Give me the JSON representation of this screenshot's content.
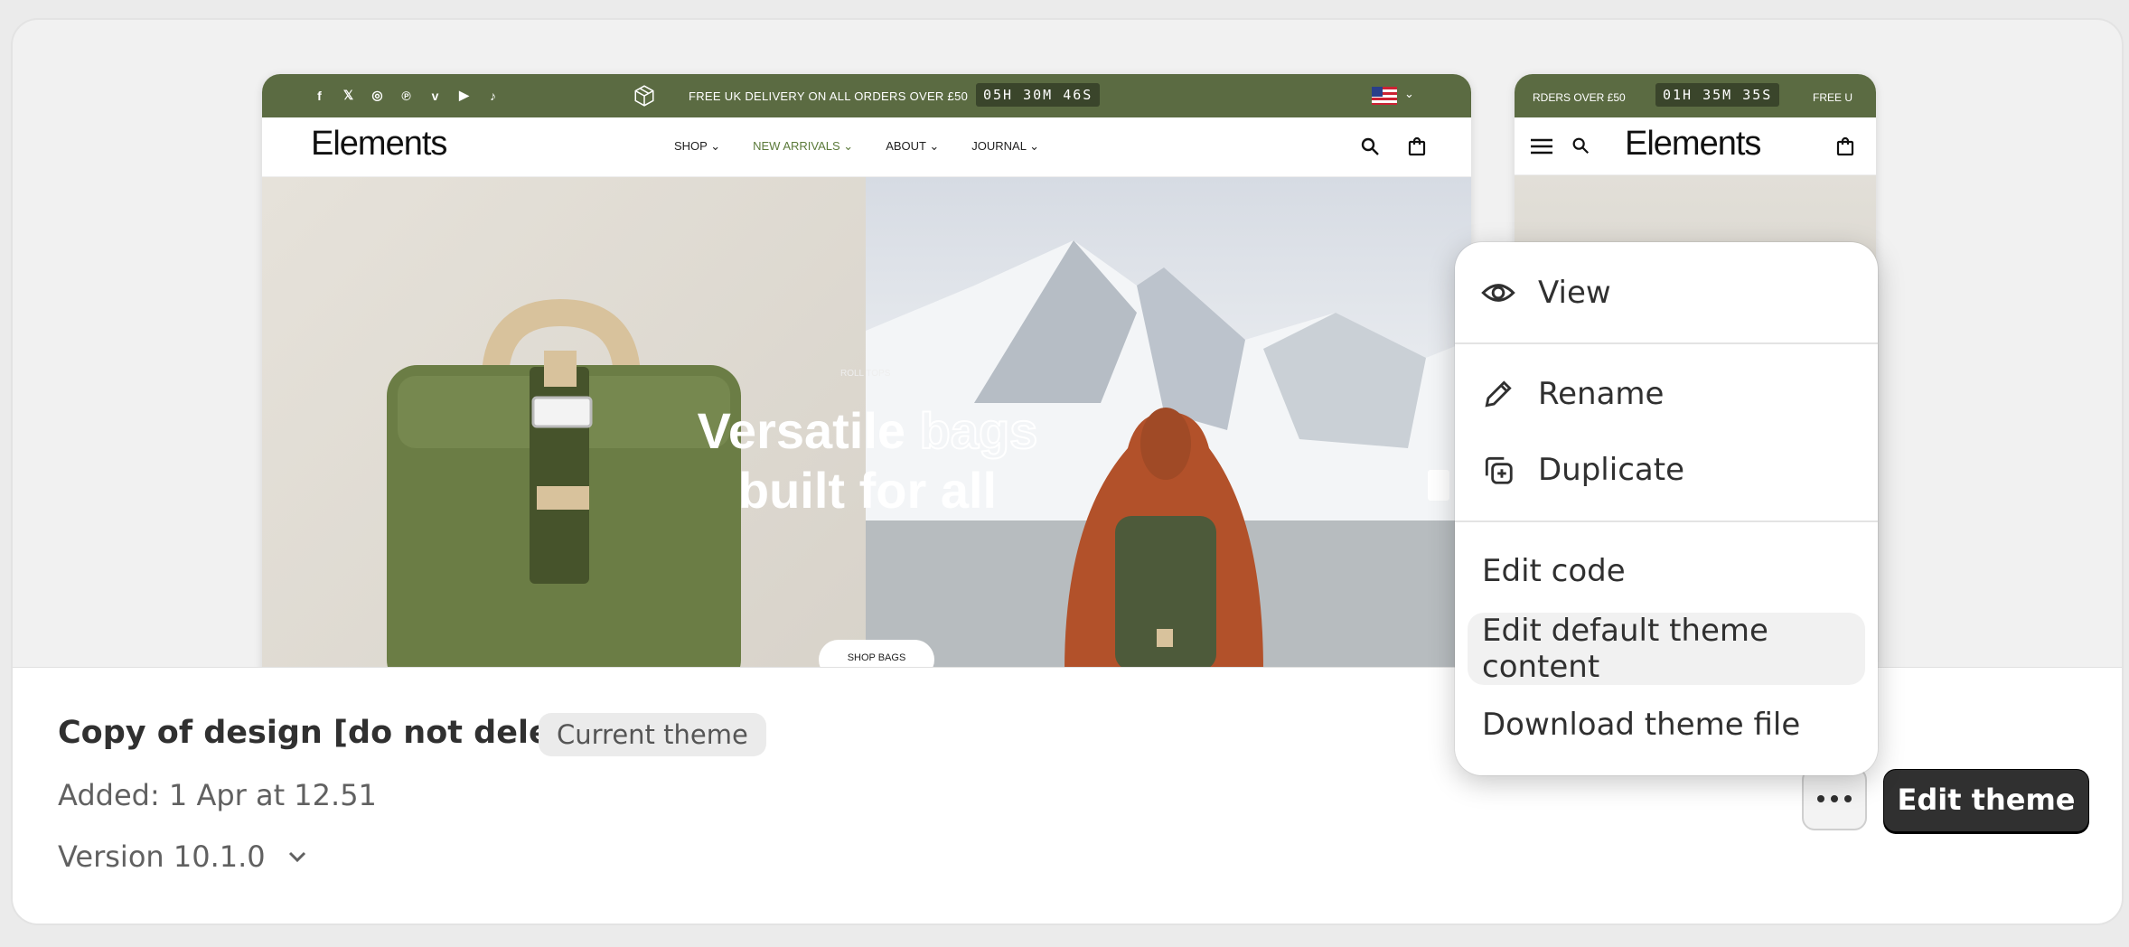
{
  "desktop_preview": {
    "announcement": "FREE UK DELIVERY ON ALL ORDERS OVER £50",
    "timer": "05H 30M 46S",
    "logo": "Elements",
    "menu": [
      "SHOP",
      "NEW ARRIVALS",
      "ABOUT",
      "JOURNAL"
    ],
    "hero_subtitle": "ROLL TOPS",
    "hero_title_a": "Versatile ",
    "hero_title_b": "bags",
    "hero_title_c": "built for all",
    "hero_button": "SHOP BAGS"
  },
  "mobile_preview": {
    "announcement_a": "RDERS OVER £50",
    "timer": "01H 35M 35S",
    "announcement_b": "FREE U",
    "logo": "Elements"
  },
  "theme": {
    "name": "Copy of design [do not delete]",
    "badge": "Current theme",
    "added": "Added: 1 Apr at 12.51",
    "version": "Version 10.1.0"
  },
  "actions": {
    "edit_theme": "Edit theme"
  },
  "menu": {
    "view": "View",
    "rename": "Rename",
    "duplicate": "Duplicate",
    "edit_code": "Edit code",
    "edit_default_content": "Edit default theme content",
    "download": "Download theme file"
  }
}
